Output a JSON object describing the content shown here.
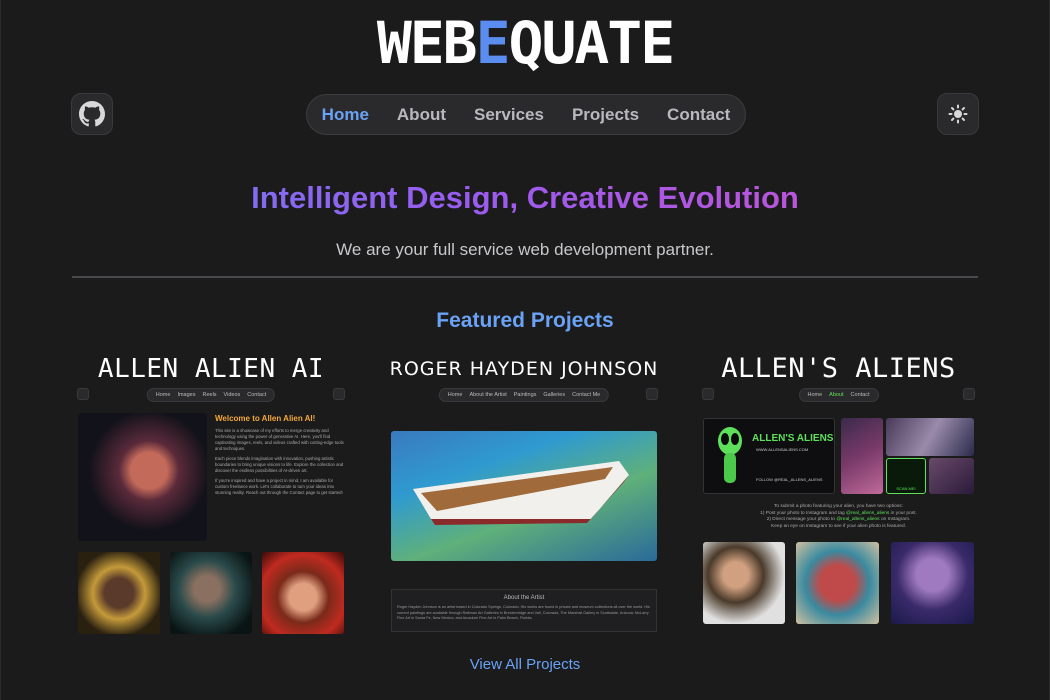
{
  "brand": {
    "prefix": "WEB",
    "highlight": "E",
    "suffix": "QUATE",
    "accent": "#5b8cf0"
  },
  "nav": {
    "items": [
      {
        "label": "Home",
        "active": true
      },
      {
        "label": "About",
        "active": false
      },
      {
        "label": "Services",
        "active": false
      },
      {
        "label": "Projects",
        "active": false
      },
      {
        "label": "Contact",
        "active": false
      }
    ],
    "github_icon": "github-icon",
    "theme_icon": "sun-icon"
  },
  "hero": {
    "title": "Intelligent Design, Creative Evolution",
    "subtitle": "We are your full service web development partner."
  },
  "featured": {
    "heading": "Featured Projects",
    "projects": [
      {
        "title": "ALLEN ALIEN AI",
        "mini_nav": [
          "Home",
          "Images",
          "Reels",
          "Videos",
          "Contact"
        ],
        "welcome_title": "Welcome to Allen Alien AI!",
        "welcome_p1": "This site is a showcase of my efforts to merge creativity and technology using the power of generative AI. Here, you'll find captivating images, reels, and videos crafted with cutting-edge tools and techniques.",
        "welcome_p2": "Each piece blends imagination with innovation, pushing artistic boundaries to bring unique visions to life. Explore the collection and discover the endless possibilities of AI-driven art.",
        "welcome_p3": "If you're inspired and have a project in mind, I am available for custom freelance work. Let's collaborate to turn your ideas into stunning reality. Reach out through the Contact page to get started!"
      },
      {
        "title": "ROGER HAYDEN JOHNSON",
        "mini_nav": [
          "Home",
          "About the Artist",
          "Paintings",
          "Galleries",
          "Contact Me"
        ],
        "about_heading": "About the Artist",
        "about_text": "Roger Hayden Johnson is an artist based in Colorado Springs, Colorado. His works are found in private and museum collections all over the world. His current paintings are available through Rattman Art Galleries in Breckenridge and Vail, Colorado; The Marshall Gallery in Scottsdale, Arizona; McLarry Fine Art in Santa Fe, New Mexico; and Arcadure Fine Art in Palm Beach, Florida."
      },
      {
        "title": "ALLEN'S ALIENS",
        "mini_nav": [
          "Home",
          "About",
          "Contact"
        ],
        "active_nav": "About",
        "banner_title": "ALLEN'S ALIENS",
        "banner_url": "WWW.ALLENSALIENS.COM",
        "banner_follow": "FOLLOW @REAL_ALLENS_ALIENS",
        "qr_label": "SCAN ME!",
        "submit_line1": "To submit a photo featuring your alien, you have two options:",
        "submit_line2a": "1) Post your photo to Instagram and tag",
        "submit_handle": "@real_allens_aliens",
        "submit_line2b": "in your post.",
        "submit_line3a": "2) Direct message your photo to",
        "submit_line3b": "on Instagram.",
        "submit_line4": "Keep an eye on Instagram to see if your alien photo is featured."
      }
    ],
    "view_all": "View All Projects"
  }
}
